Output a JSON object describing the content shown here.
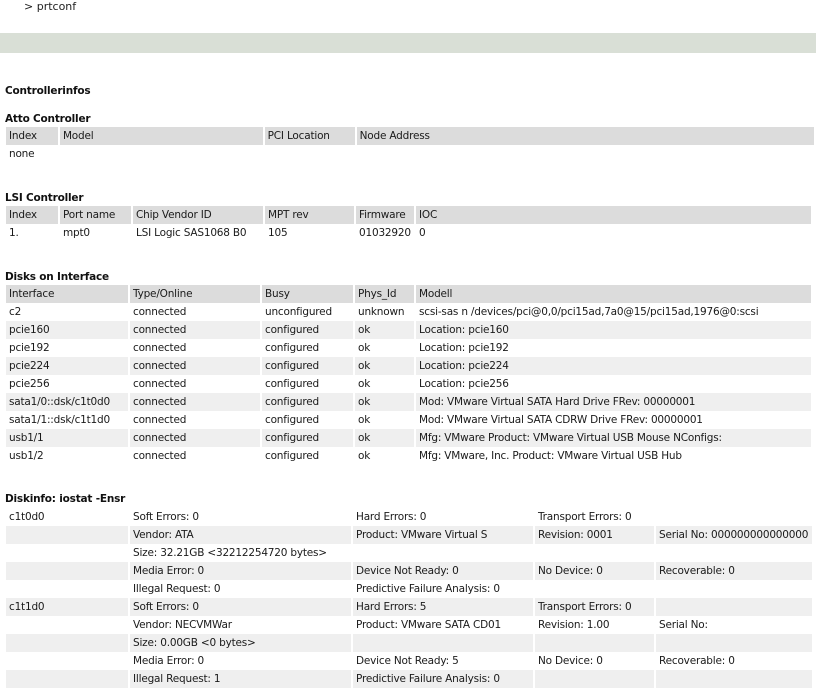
{
  "top_line": "> prtconf",
  "sections": {
    "controllerinfos": "Controllerinfos",
    "atto": {
      "title": "Atto Controller",
      "headers": [
        "Index",
        "Model",
        "PCI Location",
        "Node Address"
      ],
      "rows": [
        [
          "none",
          "",
          "",
          ""
        ]
      ]
    },
    "lsi": {
      "title": "LSI Controller",
      "headers": [
        "Index",
        "Port name",
        "Chip Vendor ID",
        "MPT rev",
        "Firmware",
        "IOC"
      ],
      "rows": [
        [
          "1.",
          "mpt0",
          "LSI Logic SAS1068 B0",
          "105",
          "01032920",
          "0"
        ]
      ]
    },
    "disks": {
      "title": "Disks on Interface",
      "headers": [
        "Interface",
        "Type/Online",
        "Busy",
        "Phys_Id",
        "Modell"
      ],
      "rows": [
        [
          "c2",
          "connected",
          "unconfigured",
          "unknown",
          "scsi-sas n /devices/pci@0,0/pci15ad,7a0@15/pci15ad,1976@0:scsi"
        ],
        [
          "pcie160",
          "connected",
          "configured",
          "ok",
          "Location: pcie160"
        ],
        [
          "pcie192",
          "connected",
          "configured",
          "ok",
          "Location: pcie192"
        ],
        [
          "pcie224",
          "connected",
          "configured",
          "ok",
          "Location: pcie224"
        ],
        [
          "pcie256",
          "connected",
          "configured",
          "ok",
          "Location: pcie256"
        ],
        [
          "sata1/0::dsk/c1t0d0",
          "connected",
          "configured",
          "ok",
          "Mod: VMware Virtual SATA Hard Drive FRev: 00000001"
        ],
        [
          "sata1/1::dsk/c1t1d0",
          "connected",
          "configured",
          "ok",
          "Mod: VMware Virtual SATA CDRW Drive FRev: 00000001"
        ],
        [
          "usb1/1",
          "connected",
          "configured",
          "ok",
          "Mfg: VMware Product: VMware Virtual USB Mouse NConfigs:"
        ],
        [
          "usb1/2",
          "connected",
          "configured",
          "ok",
          "Mfg: VMware, Inc. Product: VMware Virtual USB Hub"
        ]
      ]
    },
    "diskinfo": {
      "title": "Diskinfo: iostat -Ensr",
      "rows": [
        [
          "c1t0d0",
          "Soft Errors: 0",
          "Hard Errors: 0",
          "Transport Errors: 0",
          ""
        ],
        [
          "",
          "Vendor: ATA",
          "Product: VMware Virtual S",
          "Revision: 0001",
          "Serial No: 000000000000000"
        ],
        [
          "",
          "Size: 32.21GB <32212254720 bytes>",
          "",
          "",
          ""
        ],
        [
          "",
          "Media Error: 0",
          "Device Not Ready: 0",
          "No Device: 0",
          "Recoverable: 0"
        ],
        [
          "",
          "Illegal Request: 0",
          "Predictive Failure Analysis: 0",
          "",
          ""
        ],
        [
          "c1t1d0",
          "Soft Errors: 0",
          "Hard Errors: 5",
          "Transport Errors: 0",
          ""
        ],
        [
          "",
          "Vendor: NECVMWar",
          "Product: VMware SATA CD01",
          "Revision: 1.00",
          "Serial No:"
        ],
        [
          "",
          "Size: 0.00GB <0 bytes>",
          "",
          "",
          ""
        ],
        [
          "",
          "Media Error: 0",
          "Device Not Ready: 5",
          "No Device: 0",
          "Recoverable: 0"
        ],
        [
          "",
          "Illegal Request: 1",
          "Predictive Failure Analysis: 0",
          "",
          ""
        ]
      ]
    }
  }
}
